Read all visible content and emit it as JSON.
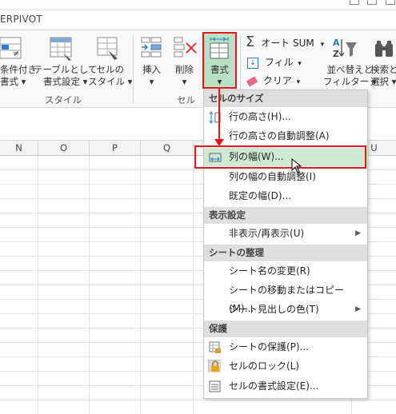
{
  "ribbon": {
    "tab_label": "ERPIVOT",
    "conditional_format_label_1": "条件付き",
    "conditional_format_label_2": "書式",
    "table_format_label_1": "テーブルとして",
    "table_format_label_2": "書式設定",
    "cell_style_label_1": "セルの",
    "cell_style_label_2": "スタイル",
    "insert_label": "挿入",
    "delete_label": "削除",
    "format_label": "書式",
    "autosum_label": "オート SUM",
    "fill_label": "フィル",
    "clear_label": "クリア",
    "sort_filter_label_1": "並べ替えと",
    "sort_filter_label_2": "フィルター",
    "find_select_label_1": "検索と",
    "find_select_label_2": "選択",
    "group_styles": "スタイル",
    "group_cells": "セル"
  },
  "columns": [
    "N",
    "O",
    "P",
    "Q",
    "U"
  ],
  "menu": {
    "header_cell_size": "セルのサイズ",
    "row_height": "行の高さ(H)...",
    "row_autofit": "行の高さの自動調整(A)",
    "column_width": "列の幅(W)...",
    "column_autofit": "列の幅の自動調整(I)",
    "default_width": "既定の幅(D)...",
    "header_visibility": "表示設定",
    "hide_unhide": "非表示/再表示(U)",
    "header_organize": "シートの整理",
    "rename_sheet": "シート名の変更(R)",
    "move_copy_sheet": "シートの移動またはコピー(M)...",
    "tab_color": "シート見出しの色(T)",
    "header_protection": "保護",
    "protect_sheet": "シートの保護(P)...",
    "lock_cell": "セルのロック(L)",
    "format_cells": "セルの書式設定(E)..."
  },
  "colors": {
    "highlight_red": "#e8141c",
    "menu_hover": "#cfe8d3",
    "format_button_active": "#b8e0c3"
  }
}
